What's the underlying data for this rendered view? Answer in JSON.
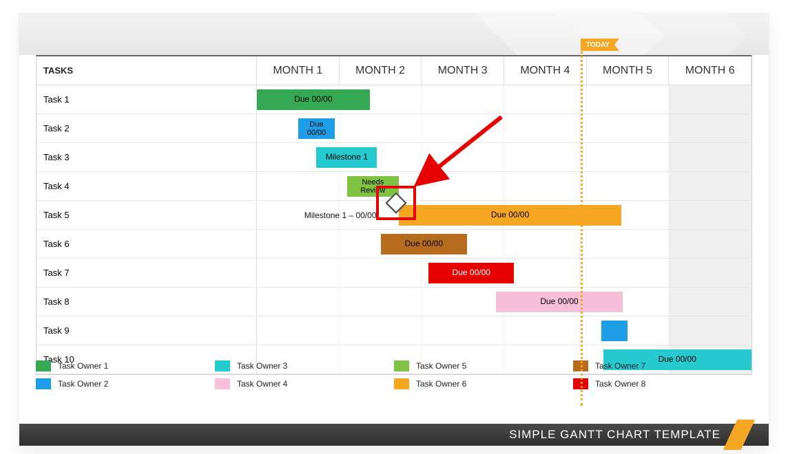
{
  "header": {
    "tasks_label": "TASKS",
    "months": [
      "MONTH 1",
      "MONTH 2",
      "MONTH 3",
      "MONTH 4",
      "MONTH 5",
      "MONTH 6"
    ]
  },
  "tasks": [
    "Task 1",
    "Task 2",
    "Task 3",
    "Task 4",
    "Task 5",
    "Task 6",
    "Task 7",
    "Task 8",
    "Task 9",
    "Task 10"
  ],
  "today_label": "TODAY",
  "footer_title": "SIMPLE GANTT CHART TEMPLATE",
  "bars": {
    "t1": "Due 00/00",
    "t2": "Due\n00/00",
    "t3": "Milestone 1",
    "t4": "Needs\nReview",
    "t5_pre": "Milestone 1 – 00/00",
    "t5": "Due 00/00",
    "t6": "Due 00/00",
    "t7": "Due 00/00",
    "t8": "Due 00/00",
    "t9": "",
    "t10": "Due 00/00"
  },
  "legend": [
    {
      "label": "Task Owner 1",
      "color_class": "c1"
    },
    {
      "label": "Task Owner 3",
      "color_class": "c3"
    },
    {
      "label": "Task Owner 5",
      "color_class": "c5"
    },
    {
      "label": "Task Owner 7",
      "color_class": "c7"
    },
    {
      "label": "Task Owner 2",
      "color_class": "c2"
    },
    {
      "label": "Task Owner 4",
      "color_class": "c4"
    },
    {
      "label": "Task Owner 6",
      "color_class": "c6"
    },
    {
      "label": "Task Owner 8",
      "color_class": "c8"
    }
  ],
  "colors": {
    "owner1": "#34a853",
    "owner2": "#1f9ee8",
    "owner3": "#25c9d0",
    "owner4": "#f7bfd8",
    "owner5": "#80c342",
    "owner6": "#f5a623",
    "owner7": "#b76b1c",
    "owner8": "#e60000"
  },
  "chart_data": {
    "type": "bar",
    "orientation": "gantt",
    "x_axis": {
      "unit": "month",
      "categories": [
        "MONTH 1",
        "MONTH 2",
        "MONTH 3",
        "MONTH 4",
        "MONTH 5",
        "MONTH 6"
      ],
      "range": [
        0,
        6
      ]
    },
    "today_position": 4.05,
    "milestone": {
      "row": "Task 5",
      "position": 1.5,
      "label": "Milestone 1 – 00/00",
      "highlighted": true
    },
    "series": [
      {
        "row": "Task 1",
        "start": 0.0,
        "end": 1.37,
        "owner": "Task Owner 1",
        "color": "#34a853",
        "label": "Due 00/00"
      },
      {
        "row": "Task 2",
        "start": 0.5,
        "end": 0.95,
        "owner": "Task Owner 2",
        "color": "#1f9ee8",
        "label": "Due 00/00"
      },
      {
        "row": "Task 3",
        "start": 0.72,
        "end": 1.46,
        "owner": "Task Owner 3",
        "color": "#25c9d0",
        "label": "Milestone 1"
      },
      {
        "row": "Task 4",
        "start": 1.09,
        "end": 1.72,
        "owner": "Task Owner 5",
        "color": "#80c342",
        "label": "Needs Review"
      },
      {
        "row": "Task 5",
        "start": 1.72,
        "end": 4.42,
        "owner": "Task Owner 6",
        "color": "#f5a623",
        "label": "Due 00/00"
      },
      {
        "row": "Task 6",
        "start": 1.5,
        "end": 2.55,
        "owner": "Task Owner 7",
        "color": "#b76b1c",
        "label": "Due 00/00"
      },
      {
        "row": "Task 7",
        "start": 2.08,
        "end": 3.12,
        "owner": "Task Owner 8",
        "color": "#e60000",
        "label": "Due 00/00"
      },
      {
        "row": "Task 8",
        "start": 2.9,
        "end": 4.44,
        "owner": "Task Owner 4",
        "color": "#f7bfd8",
        "label": "Due 00/00"
      },
      {
        "row": "Task 9",
        "start": 4.18,
        "end": 4.5,
        "owner": "Task Owner 2",
        "color": "#1f9ee8",
        "label": ""
      },
      {
        "row": "Task 10",
        "start": 4.2,
        "end": 6.0,
        "owner": "Task Owner 3",
        "color": "#25c9d0",
        "label": "Due 00/00"
      }
    ],
    "legend": [
      "Task Owner 1",
      "Task Owner 2",
      "Task Owner 3",
      "Task Owner 4",
      "Task Owner 5",
      "Task Owner 6",
      "Task Owner 7",
      "Task Owner 8"
    ],
    "annotation": {
      "type": "arrow",
      "target": "milestone on Task 5",
      "from": [
        2.85,
        2.5
      ],
      "to": [
        1.75,
        4.4
      ],
      "color": "#e60000"
    }
  }
}
